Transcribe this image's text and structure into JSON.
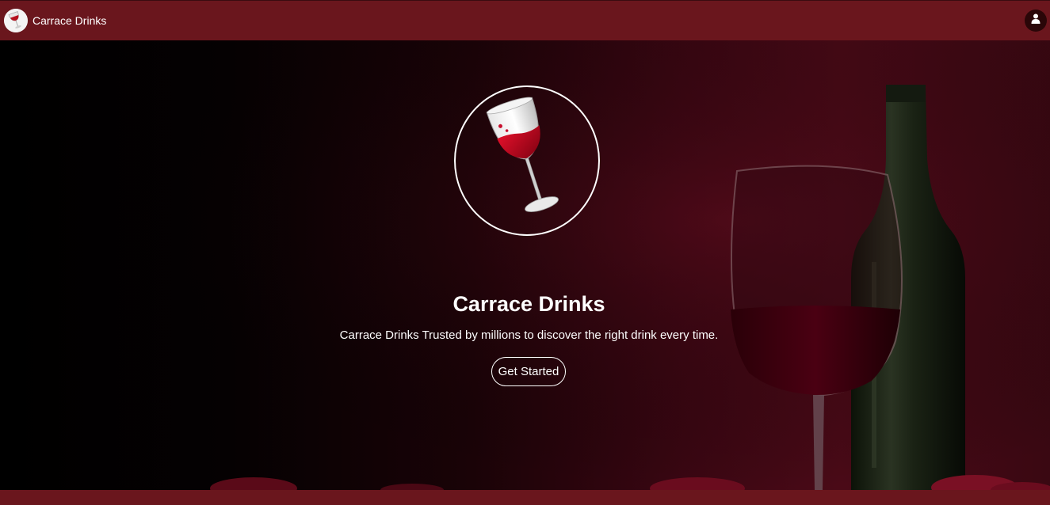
{
  "navbar": {
    "brand_name": "Carrace Drinks",
    "logo_icon": "wine-glass-icon",
    "user_icon": "user-icon"
  },
  "hero": {
    "title": "Carrace Drinks",
    "subtitle": "Carrace Drinks Trusted by millions to discover the right drink every time.",
    "cta_label": "Get Started",
    "emblem_icon": "wine-glass-icon",
    "background": "wine-bottle-and-glass-photo"
  },
  "colors": {
    "navbar_bg": "#6a161d",
    "accent_wine": "#c8102e",
    "text": "#ffffff"
  }
}
